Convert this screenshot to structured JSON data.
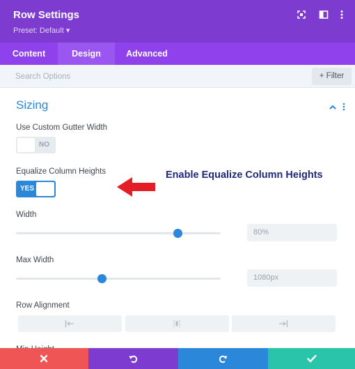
{
  "header": {
    "title": "Row Settings",
    "preset": "Preset: Default ▾"
  },
  "tabs": [
    {
      "label": "Content",
      "active": false
    },
    {
      "label": "Design",
      "active": true
    },
    {
      "label": "Advanced",
      "active": false
    }
  ],
  "search": {
    "placeholder": "Search Options",
    "filter_label": "+ Filter"
  },
  "section": {
    "title": "Sizing"
  },
  "fields": {
    "gutter": {
      "label": "Use Custom Gutter Width",
      "state": "NO"
    },
    "equalize": {
      "label": "Equalize Column Heights",
      "state": "YES"
    },
    "width": {
      "label": "Width",
      "value": "80%",
      "fraction": 0.79
    },
    "max_width": {
      "label": "Max Width",
      "value": "1080px",
      "fraction": 0.42
    },
    "alignment": {
      "label": "Row Alignment"
    },
    "min_height": {
      "label": "Min Height"
    }
  },
  "annotation": {
    "text": "Enable Equalize Column Heights"
  },
  "colors": {
    "header_purple": "#7e3bd0",
    "tab_purple": "#8f42ec",
    "accent_blue": "#2b87da",
    "annotation_arrow": "#e41e26",
    "footer_cancel": "#ef5555",
    "footer_undo": "#7e3bd0",
    "footer_redo": "#2b87da",
    "footer_save": "#29c4a9"
  },
  "icons": {
    "header": [
      "expand-icon",
      "split-view-icon",
      "more-options-icon"
    ],
    "section": [
      "chevron-up-icon",
      "more-options-icon"
    ],
    "alignment": [
      "align-left-icon",
      "align-center-icon",
      "align-right-icon"
    ],
    "footer": [
      "close-icon",
      "undo-icon",
      "redo-icon",
      "check-icon"
    ]
  }
}
